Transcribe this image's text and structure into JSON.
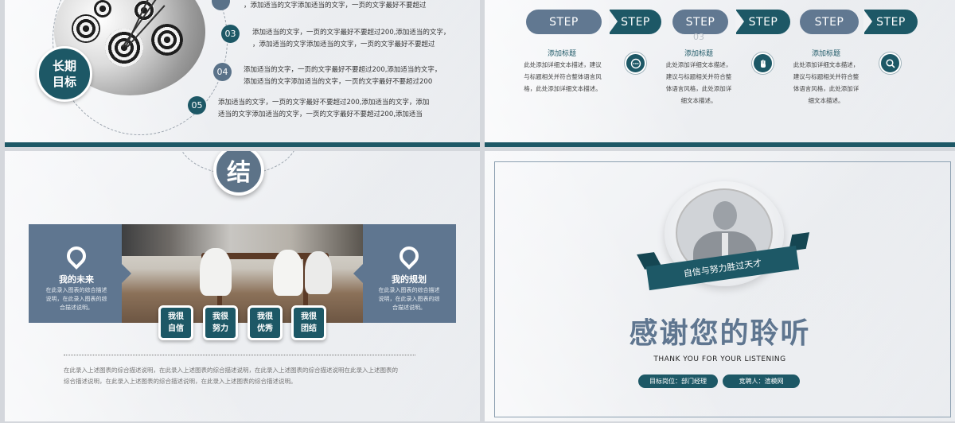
{
  "slide1": {
    "goal_line1": "长期",
    "goal_line2": "目标",
    "items": [
      {
        "num": "",
        "line1": "，添加适当的文字添加适当的文字，一页的文字最好不要超过",
        "line2": ""
      },
      {
        "num": "03",
        "line1": "添加适当的文字，一页的文字最好不要超过200,添加适当的文字，",
        "line2": "，添加适当的文字添加适当的文字，一页的文字最好不要超过"
      },
      {
        "num": "04",
        "line1": "添加适当的文字，一页的文字最好不要超过200,添加适当的文字，",
        "line2": "添加适当的文字添加适当的文字，一页的文字最好不要超过200"
      },
      {
        "num": "05",
        "line1": "添加适当的文字，一页的文字最好不要超过200,添加适当的文字，添加",
        "line2": "适当的文字添加适当的文字，一页的文字最好不要超过200,添加适当"
      }
    ]
  },
  "slide2": {
    "steps": [
      "STEP",
      "STEP",
      "STEP",
      "STEP",
      "STEP",
      "STEP"
    ],
    "faint_num": "03",
    "columns": [
      {
        "title": "添加标题",
        "lines": [
          "此处添加详细文本描述，建议",
          "与标题相关并符合整体语言风",
          "格，此处添加详细文本描述。"
        ]
      },
      {
        "title": "添加标题",
        "lines": [
          "此处添加详细文本描述，",
          "建议与标题相关并符合整",
          "体语言风格，此处添加详",
          "细文本描述。"
        ]
      },
      {
        "title": "添加标题",
        "lines": [
          "此处添加详细文本描述，",
          "建议与标题相关并符合整",
          "体语言风格，此处添加详",
          "细文本描述。"
        ]
      }
    ],
    "icons": [
      "chat-icon",
      "hand-icon",
      "search-icon"
    ]
  },
  "slide3": {
    "heading_char": "结",
    "left_title": "我的未来",
    "left_desc": [
      "在此录入图表的综合描述",
      "说明，在此录入图表的综",
      "合描述说明。"
    ],
    "right_title": "我的规划",
    "right_desc": [
      "在此录入图表的综合描述",
      "说明，在此录入图表的综",
      "合描述说明。"
    ],
    "tags": [
      {
        "l1": "我很",
        "l2": "自信"
      },
      {
        "l1": "我很",
        "l2": "努力"
      },
      {
        "l1": "我很",
        "l2": "优秀"
      },
      {
        "l1": "我很",
        "l2": "团结"
      }
    ],
    "footer_line1": "在此录入上述图表的综合描述说明，在此录入上述图表的综合描述说明，在此录入上述图表的综合描述说明在此录入上述图表的",
    "footer_line2": "综合描述说明，在此录入上述图表的综合描述说明，在此录入上述图表的综合描述说明。"
  },
  "slide4": {
    "ribbon": "自信与努力胜过天才",
    "thanks": "感谢您的聆听",
    "thanks_en": "THANK YOU FOR YOUR LISTENING",
    "pill1": "目标岗位：部门经理",
    "pill2": "竞聘人：渲模网"
  },
  "colors": {
    "teal": "#1d5866",
    "slate": "#5f7690"
  }
}
